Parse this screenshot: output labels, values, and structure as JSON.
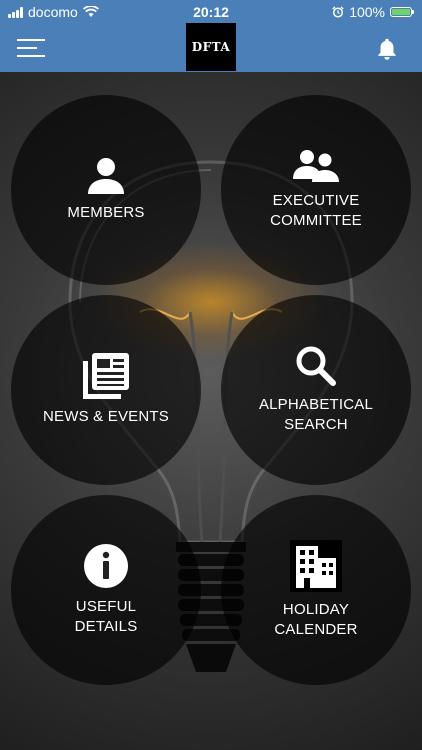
{
  "status_bar": {
    "carrier": "docomo",
    "time": "20:12",
    "battery_percent": "100%",
    "icons": [
      "signal-icon",
      "wifi-icon",
      "alarm-icon",
      "battery-charging-icon"
    ]
  },
  "nav": {
    "logo_text": "DFTA",
    "icons": [
      "hamburger-menu-icon",
      "bell-icon"
    ]
  },
  "colors": {
    "header": "#4a7fb8",
    "tile_bg": "rgba(0,0,0,0.62)",
    "text": "#ffffff"
  },
  "menu_tiles": [
    {
      "label": "MEMBERS",
      "icon": "person-icon"
    },
    {
      "label": "EXECUTIVE\nCOMMITTEE",
      "icon": "group-icon"
    },
    {
      "label": "NEWS & EVENTS",
      "icon": "news-icon"
    },
    {
      "label": "ALPHABETICAL\nSEARCH",
      "icon": "search-icon"
    },
    {
      "label": "USEFUL\nDETAILS",
      "icon": "info-icon"
    },
    {
      "label": "HOLIDAY\nCALENDER",
      "icon": "building-icon"
    }
  ]
}
